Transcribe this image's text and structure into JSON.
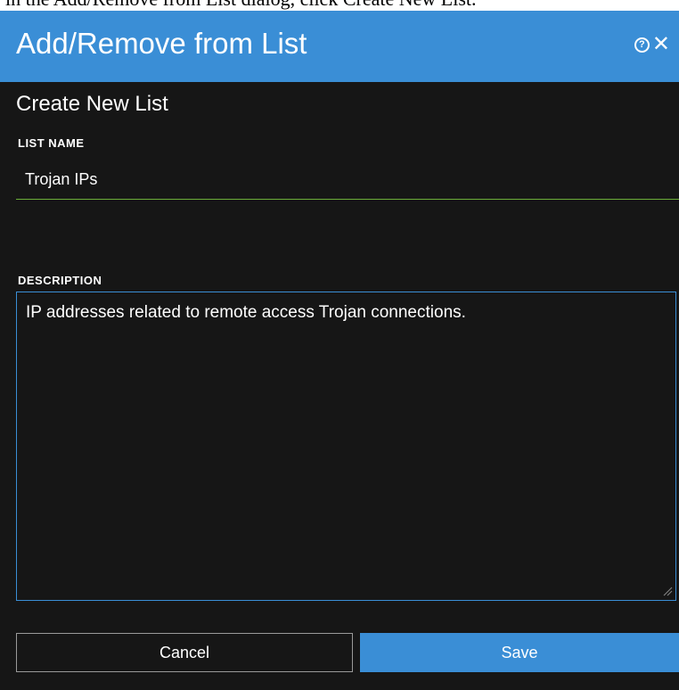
{
  "caption": "in the Add/Remove from List dialog, click Create New List.",
  "dialog": {
    "title": "Add/Remove from List",
    "section_title": "Create New List",
    "list_name": {
      "label": "LIST NAME",
      "value": "Trojan IPs"
    },
    "description": {
      "label": "DESCRIPTION",
      "value": "IP addresses related to remote access Trojan connections."
    },
    "buttons": {
      "cancel_label": "Cancel",
      "save_label": "Save"
    }
  },
  "colors": {
    "title_bar": "#3a8ed6",
    "dialog_bg": "#161616",
    "name_underline": "#6cae3a",
    "save_button": "#3a8ed6"
  },
  "icons": [
    "help-icon",
    "close-icon",
    "resize-handle-icon"
  ]
}
